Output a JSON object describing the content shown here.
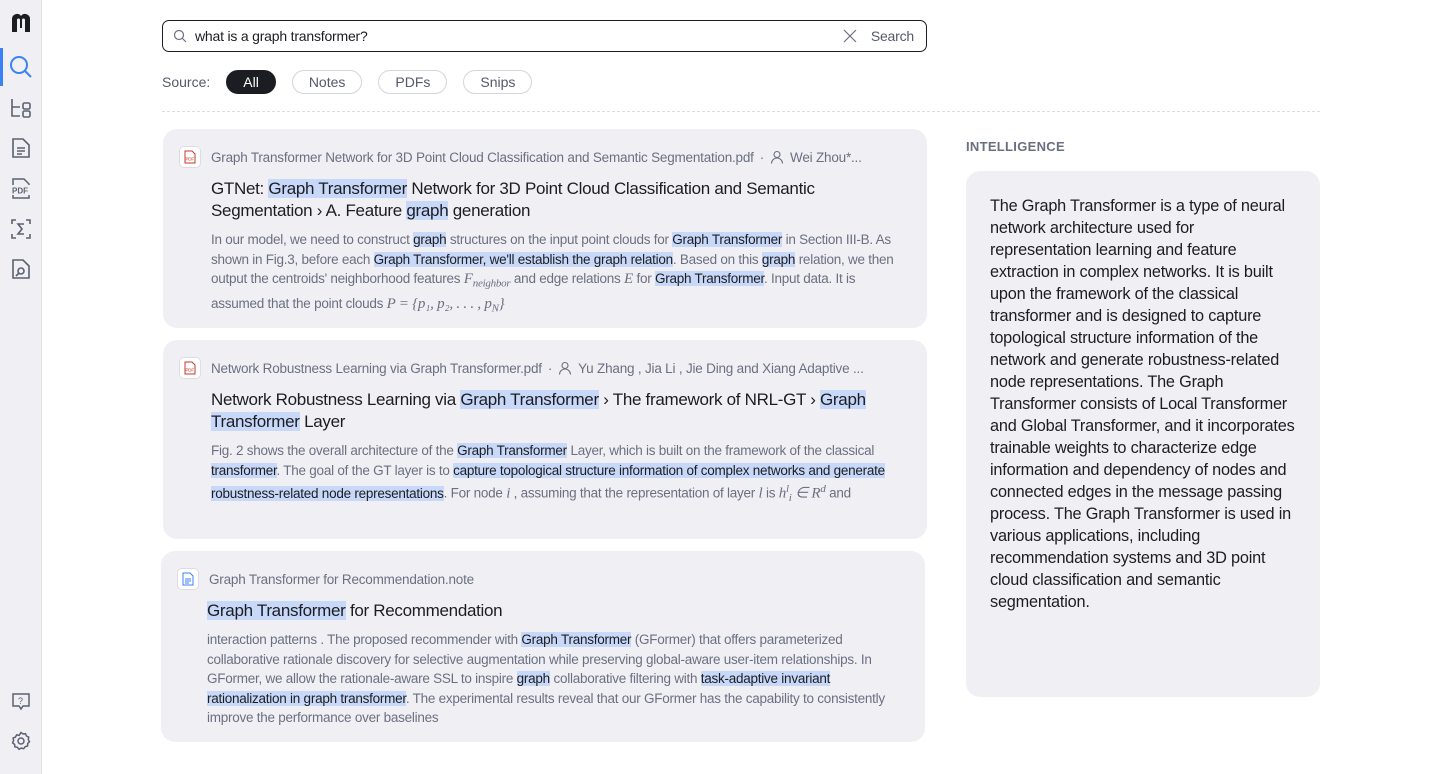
{
  "sidebar": {
    "items": [
      {
        "name": "logo",
        "icon": "logo-icon"
      },
      {
        "name": "search",
        "icon": "search-icon",
        "active": true
      },
      {
        "name": "library",
        "icon": "tree-icon"
      },
      {
        "name": "notes",
        "icon": "document-icon"
      },
      {
        "name": "pdfs",
        "icon": "pdf-icon"
      },
      {
        "name": "formula",
        "icon": "sigma-icon"
      },
      {
        "name": "snips",
        "icon": "file-search-icon"
      }
    ],
    "bottom": [
      {
        "name": "help",
        "icon": "help-icon"
      },
      {
        "name": "settings",
        "icon": "gear-icon"
      }
    ]
  },
  "search": {
    "value": "what is a graph transformer?",
    "button": "Search"
  },
  "filters": {
    "label": "Source:",
    "options": [
      "All",
      "Notes",
      "PDFs",
      "Snips"
    ],
    "selected": "All"
  },
  "colors": {
    "accent": "#3b82f6",
    "highlight": "#c7d8f8",
    "card": "#f0f0f4"
  },
  "results": [
    {
      "type": "pdf",
      "file": "Graph Transformer Network for 3D Point Cloud Classification and Semantic Segmentation.pdf",
      "authors": "Wei Zhou*...",
      "title": [
        [
          "GTNet: ",
          0
        ],
        [
          "Graph Transformer",
          1
        ],
        [
          " Network for 3D Point Cloud Classification and Semantic Segmentation › A. Feature ",
          0
        ],
        [
          "graph",
          1
        ],
        [
          " generation",
          0
        ]
      ],
      "snippet": [
        [
          "In our model, we need to construct ",
          0
        ],
        [
          "graph",
          1
        ],
        [
          " structures on the input point clouds for ",
          0
        ],
        [
          "Graph Transformer",
          1
        ],
        [
          " in Section III-B. As shown in Fig.3, before each ",
          0
        ],
        [
          "Graph Transformer, we'll establish the graph relation",
          1
        ],
        [
          ". Based on this ",
          0
        ],
        [
          "graph",
          1
        ],
        [
          " relation, we then output the centroids' neighborhood features ",
          0
        ],
        [
          "F",
          2
        ],
        [
          "neighbor",
          3
        ],
        [
          " and edge relations ",
          0
        ],
        [
          "E",
          2
        ],
        [
          " for ",
          0
        ],
        [
          "Graph Transformer",
          1
        ],
        [
          ". Input data. It is assumed that the point clouds ",
          0
        ],
        [
          "P = {p₁, p₂, . . . , p",
          2
        ],
        [
          "N",
          3
        ],
        [
          "}",
          2
        ]
      ]
    },
    {
      "type": "pdf",
      "file": "Network Robustness Learning via Graph Transformer.pdf",
      "authors": "Yu Zhang , Jia Li , Jie Ding and Xiang Adaptive ...",
      "title": [
        [
          "Network Robustness Learning via ",
          0
        ],
        [
          "Graph Transformer",
          1
        ],
        [
          " › The framework of NRL-GT › ",
          0
        ],
        [
          "Graph Transformer",
          1
        ],
        [
          " Layer",
          0
        ]
      ],
      "snippet": [
        [
          "Fig. 2 shows the overall architecture of the ",
          0
        ],
        [
          "Graph Transformer",
          1
        ],
        [
          " Layer, which is built on the framework of the classical ",
          0
        ],
        [
          "transformer",
          1
        ],
        [
          ". The goal of the GT layer is to ",
          0
        ],
        [
          "capture topological structure information of complex networks and generate robustness-related node representations",
          1
        ],
        [
          ". For node ",
          0
        ],
        [
          "i",
          2
        ],
        [
          " , assuming that the representation of layer ",
          0
        ],
        [
          "l",
          2
        ],
        [
          " is ",
          0
        ],
        [
          "h",
          2
        ],
        [
          "l",
          4
        ],
        [
          "i",
          3
        ],
        [
          " ∈ R",
          2
        ],
        [
          "d",
          4
        ],
        [
          " and",
          0
        ]
      ]
    },
    {
      "type": "note",
      "file": "Graph Transformer for Recommendation.note",
      "authors": "",
      "title": [
        [
          "Graph Transformer",
          1
        ],
        [
          " for Recommendation",
          0
        ]
      ],
      "snippet": [
        [
          "interaction patterns . The proposed recommender with ",
          0
        ],
        [
          "Graph Transformer",
          1
        ],
        [
          " (GFormer) that offers parameterized collaborative rationale discovery for selective augmentation while preserving global-aware user-item relationships. In GFormer, we allow the rationale-aware SSL to inspire ",
          0
        ],
        [
          "graph",
          1
        ],
        [
          " collaborative filtering with ",
          0
        ],
        [
          "task-adaptive invariant rationalization in graph transformer",
          1
        ],
        [
          ". The experimental results reveal that our GFormer has the capability to consistently improve the performance over baselines",
          0
        ]
      ]
    }
  ],
  "intelligence": {
    "heading": "INTELLIGENCE",
    "answer": "The Graph Transformer is a type of neural network architecture used for representation learning and feature extraction in complex networks. It is built upon the framework of the classical transformer and is designed to capture topological structure information of the network and generate robustness-related node representations. The Graph Transformer consists of Local Transformer and Global Transformer, and it incorporates trainable weights to characterize edge information and dependency of nodes and connected edges in the message passing process. The Graph Transformer is used in various applications, including recommendation systems and 3D point cloud classification and semantic segmentation."
  }
}
